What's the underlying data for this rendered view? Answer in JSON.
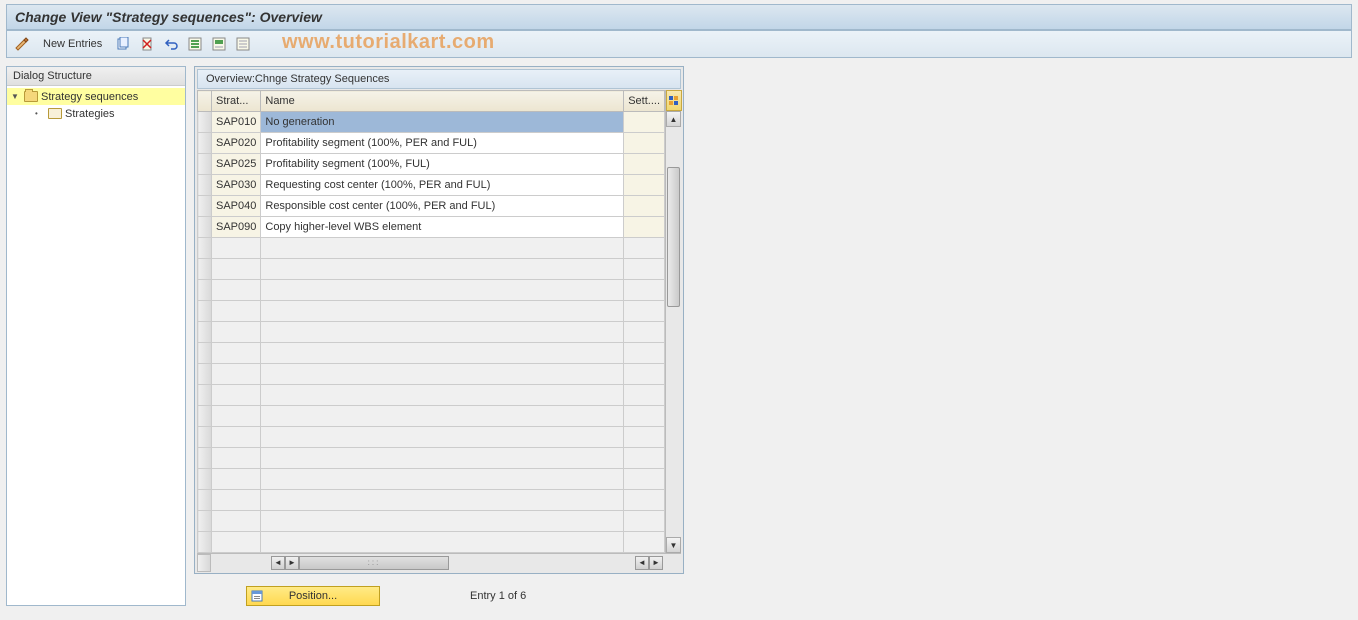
{
  "header": {
    "title": "Change View \"Strategy sequences\": Overview"
  },
  "toolbar": {
    "new_entries": "New Entries"
  },
  "watermark": "www.tutorialkart.com",
  "dialog_structure": {
    "title": "Dialog Structure",
    "root": "Strategy sequences",
    "child": "Strategies"
  },
  "grid": {
    "title": "Overview:Chnge Strategy Sequences",
    "columns": {
      "strat": "Strat...",
      "name": "Name",
      "sett": "Sett...."
    },
    "rows": [
      {
        "strat": "SAP010",
        "name": "No generation",
        "sett": ""
      },
      {
        "strat": "SAP020",
        "name": "Profitability segment (100%, PER and FUL)",
        "sett": ""
      },
      {
        "strat": "SAP025",
        "name": "Profitability segment (100%, FUL)",
        "sett": ""
      },
      {
        "strat": "SAP030",
        "name": "Requesting cost center (100%, PER and FUL)",
        "sett": ""
      },
      {
        "strat": "SAP040",
        "name": "Responsible cost center (100%, PER and FUL)",
        "sett": ""
      },
      {
        "strat": "SAP090",
        "name": "Copy higher-level WBS element",
        "sett": ""
      }
    ]
  },
  "footer": {
    "position_btn": "Position...",
    "entry_label": "Entry 1 of 6"
  }
}
